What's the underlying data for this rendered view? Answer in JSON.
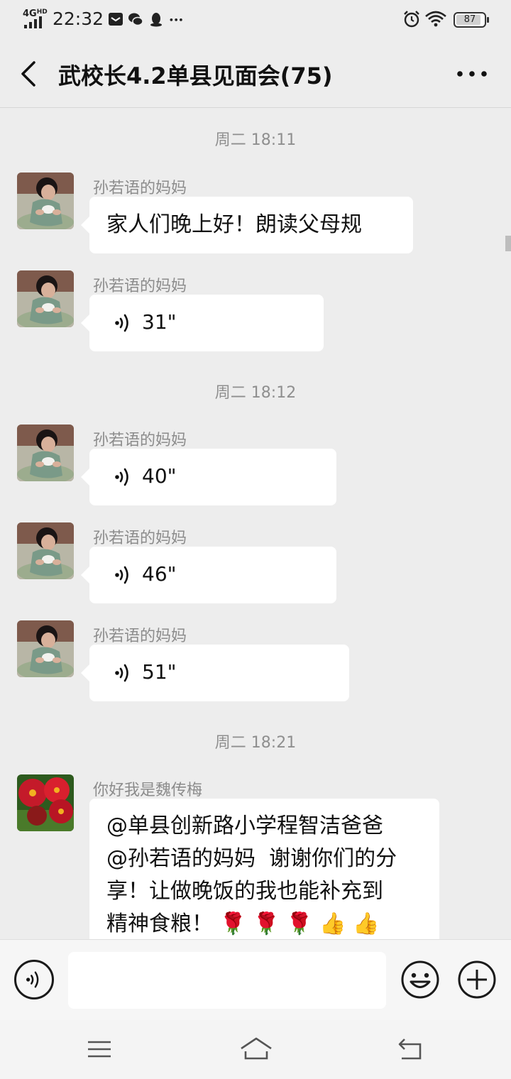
{
  "status_bar": {
    "network": "4G",
    "network_sup": "HD",
    "time": "22:32",
    "battery": "87",
    "icons": [
      "message-icon",
      "wechat-icon",
      "qq-icon",
      "more-dots-icon",
      "alarm-icon",
      "wifi-icon",
      "battery-icon"
    ]
  },
  "header": {
    "title": "武校长4.2单县见面会(75)"
  },
  "timestamps": [
    "周二 18:11",
    "周二 18:12",
    "周二 18:21"
  ],
  "messages": [
    {
      "sender": "孙若语的妈妈",
      "type": "text",
      "text": "家人们晚上好！朗读父母规"
    },
    {
      "sender": "孙若语的妈妈",
      "type": "voice",
      "duration": "31\""
    },
    {
      "sender": "孙若语的妈妈",
      "type": "voice",
      "duration": "40\""
    },
    {
      "sender": "孙若语的妈妈",
      "type": "voice",
      "duration": "46\""
    },
    {
      "sender": "孙若语的妈妈",
      "type": "voice",
      "duration": "51\""
    },
    {
      "sender": "你好我是魏传梅",
      "type": "text",
      "lines": [
        "@单县创新路小学程智洁爸爸",
        "@孙若语的妈妈  谢谢你们的分",
        "享！让做晚饭的我也能补充到",
        "精神食粮！"
      ],
      "emojis": [
        "🌹",
        "🌹",
        "🌹",
        "👍",
        "👍"
      ]
    }
  ],
  "input": {
    "placeholder": "",
    "value": ""
  },
  "colors": {
    "background": "#ededed",
    "bubble": "#ffffff",
    "text": "#111111",
    "meta_text": "#8c8c8c"
  }
}
